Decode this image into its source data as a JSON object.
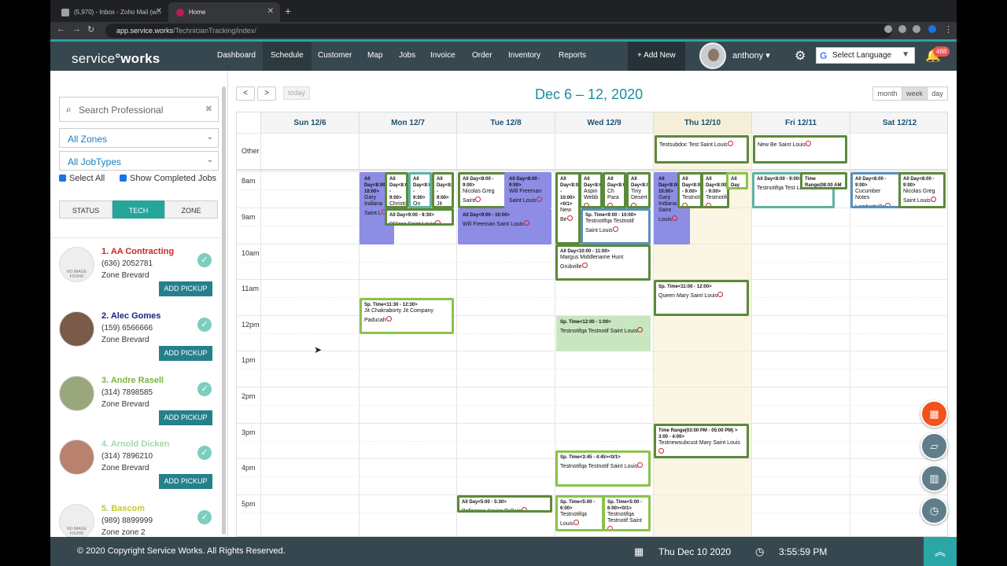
{
  "browser": {
    "tabs": [
      {
        "label": "(5,970) - Inbox - Zoho Mail (w...",
        "active": false
      },
      {
        "label": "Home",
        "active": true
      }
    ],
    "url_host": "app.service.works",
    "url_path": "/TechnicianTracking/index/"
  },
  "header": {
    "logo_a": "service",
    "logo_b": "works",
    "nav": [
      "Dashboard",
      "Schedule",
      "Customer",
      "Map",
      "Jobs",
      "Invoice",
      "Order",
      "Inventory",
      "Reports"
    ],
    "active_nav": "Schedule",
    "add_new": "+ Add New",
    "user": "anthony",
    "language": "Select Language",
    "notifications": "468"
  },
  "sidebar": {
    "search_placeholder": "Search Professional",
    "zones": "All Zones",
    "jobtypes": "All JobTypes",
    "select_all": "Select All",
    "show_completed": "Show Completed Jobs",
    "toggles": [
      "STATUS",
      "TECH",
      "ZONE"
    ],
    "active_toggle": "TECH",
    "no_image": "NO IMAGE FOUND",
    "pickup_label": "ADD PICKUP",
    "techs": [
      {
        "name": "1. AA Contracting",
        "phone": "(636) 2052781",
        "zone": "Zone Brevard",
        "color": "#c62828",
        "photo": "none"
      },
      {
        "name": "2. Alec Gomes",
        "phone": "(159) 6566666",
        "zone": "Zone Brevard",
        "color": "#1a237e",
        "photo": "man-beard"
      },
      {
        "name": "3. Andre Rasell",
        "phone": "(314) 7898585",
        "zone": "Zone Brevard",
        "color": "#7cb342",
        "photo": "man-outdoor"
      },
      {
        "name": "4. Arnold Dicken",
        "phone": "(314) 7896210",
        "zone": "Zone Brevard",
        "color": "#a5d6a7",
        "photo": "man-glasses"
      },
      {
        "name": "5. Bascom",
        "phone": "(989) 8899999",
        "zone": "Zone zone 2",
        "color": "#c0ca33",
        "photo": "none"
      }
    ]
  },
  "calendar": {
    "title": "Dec 6 – 12, 2020",
    "today": "today",
    "prev": "<",
    "next": ">",
    "views": [
      "month",
      "week",
      "day"
    ],
    "active_view": "week",
    "days": [
      "Sun 12/6",
      "Mon 12/7",
      "Tue 12/8",
      "Wed 12/9",
      "Thu 12/10",
      "Fri 12/11",
      "Sat 12/12"
    ],
    "highlight_day": "Thu 12/10",
    "other_label": "Other",
    "times": [
      "8am",
      "9am",
      "10am",
      "11am",
      "12pm",
      "1pm",
      "2pm",
      "3pm",
      "4pm",
      "5pm"
    ]
  },
  "events": [
    {
      "t": "Testsubdoc Test Saint Louis",
      "c": "dg"
    },
    {
      "t": "New Be Saint Louis",
      "c": "dg"
    },
    {
      "h": "All Day<8:00 - 10:00>",
      "t": "Gary Indiana Saint L",
      "c": "pu"
    },
    {
      "h": "All Day<8:00 - 9:00>",
      "t": "Christo Lawless",
      "c": "dg"
    },
    {
      "h": "All Day<8:00 - 9:00>",
      "t": "On Cur Saint L",
      "c": "tl"
    },
    {
      "h": "All Day<8:00 - 9:00>",
      "t": "Jit Best",
      "c": "dg"
    },
    {
      "h": "All Day<9:00 - 9:30>",
      "t": "001rec Saint Louis",
      "c": "dg"
    },
    {
      "h": "All Day<8:00 - 9:00>",
      "t": "Nicolas Greg Saint",
      "c": "dg"
    },
    {
      "h": "All Day<8:00 - 9:00>",
      "t": "Will Freeman Saint Louis",
      "c": "pu"
    },
    {
      "h": "All Day<9:00 - 10:00>",
      "t": "Will Freeman Saint Louis",
      "c": "pu"
    },
    {
      "h": "All Day<8:00 - 10:00><0/1>",
      "t": "New Be",
      "c": "dg"
    },
    {
      "h": "All Day<8:00>",
      "t": "Aspin Webb",
      "c": "dg"
    },
    {
      "h": "All Day<8:00>",
      "t": "Ch Para",
      "c": "dg"
    },
    {
      "h": "All Day<8:00>",
      "t": "Tiny Desert",
      "c": "dg"
    },
    {
      "h": "Sp. Time<9:00 - 10:00>",
      "t": "Testnotifqa Testnotif Saint Louis",
      "c": "bl"
    },
    {
      "h": "All Day<10:00 - 11:00>",
      "t": "Margus Middlename Hunt Grubville",
      "c": "dg"
    },
    {
      "h": "All Day<8:00 - 10:00>",
      "t": "Gary Indiana Saint Louis",
      "c": "pu"
    },
    {
      "h": "All Day<8:00 - 9:00>",
      "t": "Testnot",
      "c": "dg"
    },
    {
      "h": "All Day<8:00 - 9:00>",
      "t": "Testnotifqa",
      "c": "dg"
    },
    {
      "h": "All Day",
      "t": "",
      "c": "lg"
    },
    {
      "h": "All Day<8:00 - 9:00>",
      "t": "Testnotifqa Test Louis",
      "c": "tl"
    },
    {
      "h": "Time Range(08:00 AM",
      "t": "",
      "c": "dg"
    },
    {
      "h": "All Day<8:00 - 9:00>",
      "t": "Cucumber Notes Lambertville",
      "c": "bl"
    },
    {
      "h": "All Day<8:00 - 9:00>",
      "t": "Nicolas Greg Saint Louis",
      "c": "dg"
    },
    {
      "h": "Sp. Time<11:00 - 12:00>",
      "t": "Queen Mary Saint Louis",
      "c": "dg"
    },
    {
      "h": "Sp. Time<11:30 - 12:30>",
      "t": "Jit Chakraborty Jit Company Paducah",
      "c": "lg"
    },
    {
      "h": "Sp. Time<12:00 - 1:00>",
      "t": "Testnotifqa Testnotif Saint Louis",
      "c": "pale"
    },
    {
      "h": "Time Range(03:00 PM - 05:00 PM) > 3:00 - 4:00>",
      "t": "Testnewsubcust Mary Saint Louis",
      "c": "dg"
    },
    {
      "h": "Sp. Time<3:45 - 4:45><0/1>",
      "t": "Testnotifqa Testnotif Saint Louis",
      "c": "lg"
    },
    {
      "h": "All Day<5:00 - 5:30>",
      "t": "Bellacosa Xavier Ballwin",
      "c": "dg"
    },
    {
      "h": "Sp. Time<5:00 - 6:00>",
      "t": "Testnotifqa Louis",
      "c": "lg"
    },
    {
      "h": "Sp. Time<5:00 - 6:00><0/1>",
      "t": "Testnotifqa Testnotif Saint",
      "c": "lg"
    }
  ],
  "footer": {
    "copyright": "© 2020 Copyright Service Works. All Rights Reserved.",
    "date": "Thu Dec 10 2020",
    "time": "3:55:59 PM"
  },
  "colors": {
    "teal": "#1fa7a5",
    "header": "#37474f",
    "today_bg": "#fbf6e4"
  }
}
